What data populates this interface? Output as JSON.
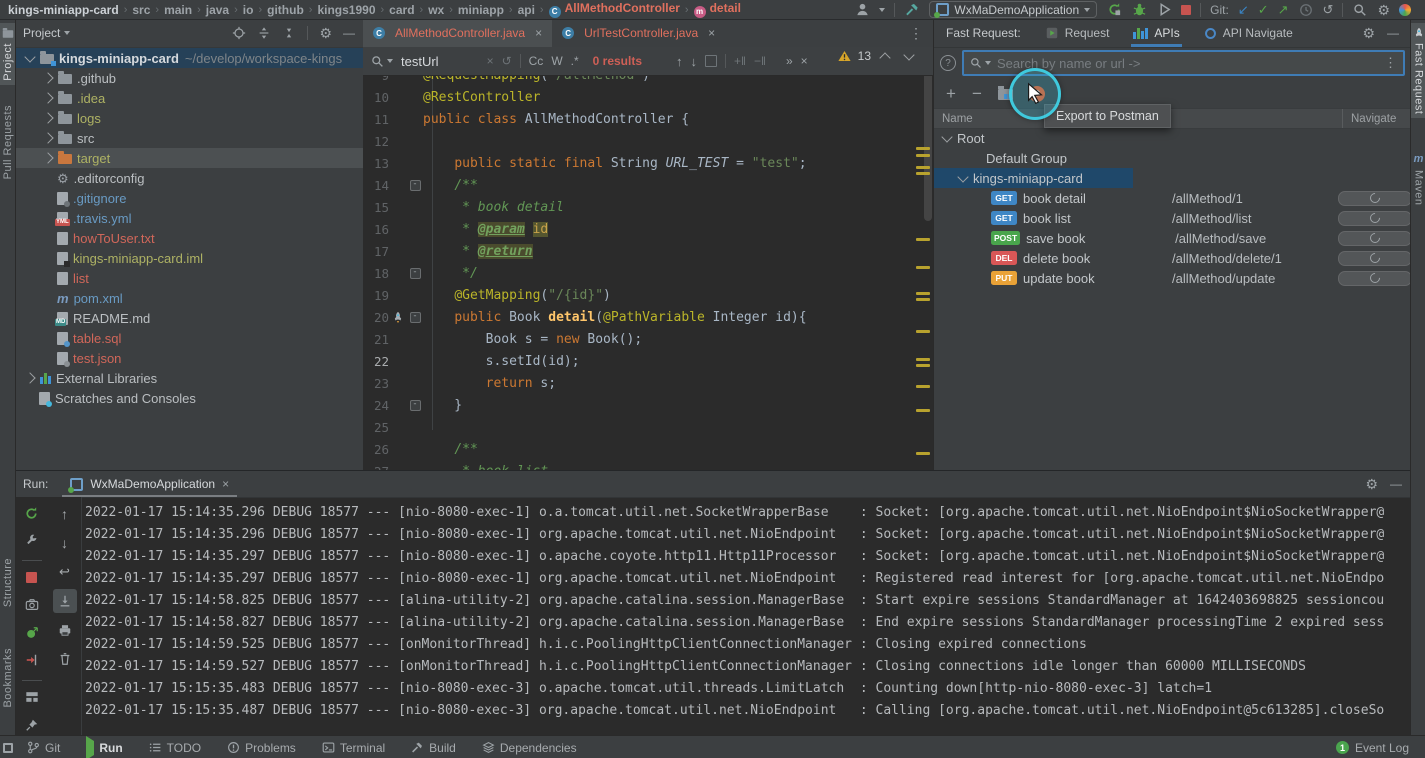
{
  "breadcrumbs": {
    "items": [
      {
        "label": "kings-miniapp-card",
        "first": true
      },
      {
        "label": "src"
      },
      {
        "label": "main"
      },
      {
        "label": "java"
      },
      {
        "label": "io"
      },
      {
        "label": "github"
      },
      {
        "label": "kings1990"
      },
      {
        "label": "card"
      },
      {
        "label": "wx"
      },
      {
        "label": "miniapp"
      },
      {
        "label": "api"
      },
      {
        "label": "AllMethodController",
        "type": "class"
      },
      {
        "label": "detail",
        "type": "method"
      }
    ]
  },
  "top_toolbar": {
    "run_config": "WxMaDemoApplication",
    "git_label": "Git:"
  },
  "left_stripe": {
    "project": "Project",
    "pull_requests": "Pull Requests",
    "structure": "Structure",
    "bookmarks": "Bookmarks"
  },
  "right_stripe": {
    "fast_request": "Fast Request",
    "maven": "Maven"
  },
  "project_panel": {
    "title": "Project",
    "tree": [
      {
        "label": "kings-miniapp-card",
        "suffix": "~/develop/workspace-kings",
        "icon": "folder-root",
        "indent": 0,
        "chevron": "down",
        "selected": true,
        "root": true
      },
      {
        "label": ".github",
        "icon": "folder",
        "indent": 1,
        "chevron": "right"
      },
      {
        "label": ".idea",
        "icon": "folder",
        "indent": 1,
        "chevron": "right",
        "color": "olive"
      },
      {
        "label": "logs",
        "icon": "folder",
        "indent": 1,
        "chevron": "right",
        "color": "olive"
      },
      {
        "label": "src",
        "icon": "folder",
        "indent": 1,
        "chevron": "right"
      },
      {
        "label": "target",
        "icon": "folder-orange",
        "indent": 1,
        "chevron": "right",
        "color": "olive",
        "hovered": true
      },
      {
        "label": ".editorconfig",
        "icon": "gear",
        "indent": 1
      },
      {
        "label": ".gitignore",
        "icon": "page-ignore",
        "indent": 1,
        "color": "blue"
      },
      {
        "label": ".travis.yml",
        "icon": "page-yml",
        "indent": 1,
        "color": "blue"
      },
      {
        "label": "howToUser.txt",
        "icon": "page",
        "indent": 1,
        "color": "red"
      },
      {
        "label": "kings-miniapp-card.iml",
        "icon": "page-iml",
        "indent": 1,
        "color": "olive"
      },
      {
        "label": "list",
        "icon": "page",
        "indent": 1,
        "color": "red"
      },
      {
        "label": "pom.xml",
        "icon": "maven",
        "indent": 1,
        "color": "blue"
      },
      {
        "label": "README.md",
        "icon": "page-md",
        "indent": 1
      },
      {
        "label": "table.sql",
        "icon": "page-sql",
        "indent": 1,
        "color": "red"
      },
      {
        "label": "test.json",
        "icon": "page-json",
        "indent": 1,
        "color": "red"
      },
      {
        "label": "External Libraries",
        "icon": "bars",
        "indent": 0,
        "chevron": "right"
      },
      {
        "label": "Scratches and Consoles",
        "icon": "scratch",
        "indent": 0
      }
    ]
  },
  "editor": {
    "tabs": [
      {
        "label": "AllMethodController.java",
        "active": true
      },
      {
        "label": "UrlTestController.java",
        "active": false
      }
    ],
    "search": {
      "query": "testUrl",
      "cc": "Cc",
      "w": "W",
      "regex": ".*",
      "results": "0 results",
      "more": "»"
    },
    "warning_count": "13",
    "lines": [
      {
        "n": "9",
        "tokens": [
          [
            "@RequestMapping",
            "ann"
          ],
          [
            "(",
            "pln"
          ],
          [
            "\"/allMethod\"",
            "str"
          ],
          [
            ")",
            "pln"
          ]
        ]
      },
      {
        "n": "10",
        "tokens": [
          [
            "@RestController",
            "ann"
          ]
        ]
      },
      {
        "n": "11",
        "tokens": [
          [
            "public class ",
            "kw"
          ],
          [
            "AllMethodController {",
            "pln"
          ]
        ]
      },
      {
        "n": "12",
        "tokens": []
      },
      {
        "n": "13",
        "tokens": [
          [
            "    ",
            "pln"
          ],
          [
            "public static final ",
            "kw"
          ],
          [
            "String ",
            "pln"
          ],
          [
            "URL_TEST ",
            "const"
          ],
          [
            "= ",
            "pln"
          ],
          [
            "\"test\"",
            "str"
          ],
          [
            ";",
            "pln"
          ]
        ]
      },
      {
        "n": "14",
        "fold": true,
        "tokens": [
          [
            "    ",
            "pln"
          ],
          [
            "/**",
            "cmt"
          ]
        ]
      },
      {
        "n": "15",
        "tokens": [
          [
            "     ",
            "pln"
          ],
          [
            "* book detail",
            "cmt"
          ]
        ]
      },
      {
        "n": "16",
        "tokens": [
          [
            "     ",
            "pln"
          ],
          [
            "* ",
            "cmt"
          ],
          [
            "@param",
            "tag"
          ],
          [
            " ",
            "cmt"
          ],
          [
            "id",
            "hl"
          ]
        ]
      },
      {
        "n": "17",
        "tokens": [
          [
            "     ",
            "pln"
          ],
          [
            "* ",
            "cmt"
          ],
          [
            "@return",
            "tag"
          ]
        ]
      },
      {
        "n": "18",
        "fold": true,
        "tokens": [
          [
            "     ",
            "pln"
          ],
          [
            "*/",
            "cmt"
          ]
        ]
      },
      {
        "n": "19",
        "tokens": [
          [
            "    ",
            "pln"
          ],
          [
            "@GetMapping",
            "ann"
          ],
          [
            "(",
            "pln"
          ],
          [
            "\"/{id}\"",
            "str"
          ],
          [
            ")",
            "pln"
          ]
        ]
      },
      {
        "n": "20",
        "fold": true,
        "rocket": true,
        "tokens": [
          [
            "    ",
            "pln"
          ],
          [
            "public ",
            "kw"
          ],
          [
            "Book ",
            "pln"
          ],
          [
            "detail",
            "meth"
          ],
          [
            "(",
            "pln"
          ],
          [
            "@PathVariable",
            "ann"
          ],
          [
            " Integer id){",
            "pln"
          ]
        ]
      },
      {
        "n": "21",
        "tokens": [
          [
            "        ",
            "pln"
          ],
          [
            "Book s = ",
            "pln"
          ],
          [
            "new ",
            "kw"
          ],
          [
            "Book();",
            "pln"
          ]
        ]
      },
      {
        "n": "22",
        "current": true,
        "tokens": [
          [
            "        ",
            "pln"
          ],
          [
            "s.setId(id);",
            "pln"
          ]
        ]
      },
      {
        "n": "23",
        "tokens": [
          [
            "        ",
            "pln"
          ],
          [
            "return ",
            "kw"
          ],
          [
            "s;",
            "pln"
          ]
        ]
      },
      {
        "n": "24",
        "fold": true,
        "tokens": [
          [
            "    }",
            "pln"
          ]
        ]
      },
      {
        "n": "25",
        "tokens": []
      },
      {
        "n": "26",
        "tokens": [
          [
            "    ",
            "pln"
          ],
          [
            "/**",
            "cmt"
          ]
        ]
      },
      {
        "n": "27",
        "tokens": [
          [
            "     ",
            "pln"
          ],
          [
            "* book list",
            "cmt"
          ]
        ]
      }
    ]
  },
  "fast_request": {
    "title": "Fast Request:",
    "tabs": [
      {
        "label": "Request",
        "icon": "request-icon"
      },
      {
        "label": "APIs",
        "icon": "bars-icon",
        "active": true
      },
      {
        "label": "API Navigate",
        "icon": "ring-icon"
      }
    ],
    "search_placeholder": "Search by name or url ->",
    "tooltip": "Export to Postman",
    "table": {
      "name_header": "Name",
      "navigate_header": "Navigate"
    },
    "tree": {
      "root": "Root",
      "group": "Default Group",
      "project": "kings-miniapp-card",
      "endpoints": [
        {
          "method": "GET",
          "color": "#3f87c5",
          "name": "book detail",
          "url": "/allMethod/1"
        },
        {
          "method": "GET",
          "color": "#3f87c5",
          "name": "book list",
          "url": "/allMethod/list"
        },
        {
          "method": "POST",
          "color": "#49a54c",
          "name": "save book",
          "url": "/allMethod/save"
        },
        {
          "method": "DEL",
          "color": "#d95757",
          "name": "delete book",
          "url": "/allMethod/delete/1"
        },
        {
          "method": "PUT",
          "color": "#e9a237",
          "name": "update book",
          "url": "/allMethod/update"
        }
      ]
    }
  },
  "run_panel": {
    "label": "Run:",
    "tab": "WxMaDemoApplication",
    "logs": [
      "2022-01-17 15:14:35.296 DEBUG 18577 --- [nio-8080-exec-1] o.a.tomcat.util.net.SocketWrapperBase    : Socket: [org.apache.tomcat.util.net.NioEndpoint$NioSocketWrapper@",
      "2022-01-17 15:14:35.296 DEBUG 18577 --- [nio-8080-exec-1] org.apache.tomcat.util.net.NioEndpoint   : Socket: [org.apache.tomcat.util.net.NioEndpoint$NioSocketWrapper@",
      "2022-01-17 15:14:35.297 DEBUG 18577 --- [nio-8080-exec-1] o.apache.coyote.http11.Http11Processor   : Socket: [org.apache.tomcat.util.net.NioEndpoint$NioSocketWrapper@",
      "2022-01-17 15:14:35.297 DEBUG 18577 --- [nio-8080-exec-1] org.apache.tomcat.util.net.NioEndpoint   : Registered read interest for [org.apache.tomcat.util.net.NioEndpo",
      "2022-01-17 15:14:58.825 DEBUG 18577 --- [alina-utility-2] org.apache.catalina.session.ManagerBase  : Start expire sessions StandardManager at 1642403698825 sessioncou",
      "2022-01-17 15:14:58.827 DEBUG 18577 --- [alina-utility-2] org.apache.catalina.session.ManagerBase  : End expire sessions StandardManager processingTime 2 expired sess",
      "2022-01-17 15:14:59.525 DEBUG 18577 --- [onMonitorThread] h.i.c.PoolingHttpClientConnectionManager : Closing expired connections",
      "2022-01-17 15:14:59.527 DEBUG 18577 --- [onMonitorThread] h.i.c.PoolingHttpClientConnectionManager : Closing connections idle longer than 60000 MILLISECONDS",
      "2022-01-17 15:15:35.483 DEBUG 18577 --- [nio-8080-exec-3] o.apache.tomcat.util.threads.LimitLatch  : Counting down[http-nio-8080-exec-3] latch=1",
      "2022-01-17 15:15:35.487 DEBUG 18577 --- [nio-8080-exec-3] org.apache.tomcat.util.net.NioEndpoint   : Calling [org.apache.tomcat.util.net.NioEndpoint@5c613285].closeSo"
    ]
  },
  "status_bar": {
    "items": [
      {
        "label": "Git",
        "icon": "git-branch-icon"
      },
      {
        "label": "Run",
        "icon": "play-icon",
        "active": true
      },
      {
        "label": "TODO",
        "icon": "todo-icon"
      },
      {
        "label": "Problems",
        "icon": "problem-icon"
      },
      {
        "label": "Terminal",
        "icon": "terminal-icon"
      },
      {
        "label": "Build",
        "icon": "hammer-icon"
      },
      {
        "label": "Dependencies",
        "icon": "layers-icon"
      }
    ],
    "event_log": "Event Log",
    "event_count": "1"
  }
}
